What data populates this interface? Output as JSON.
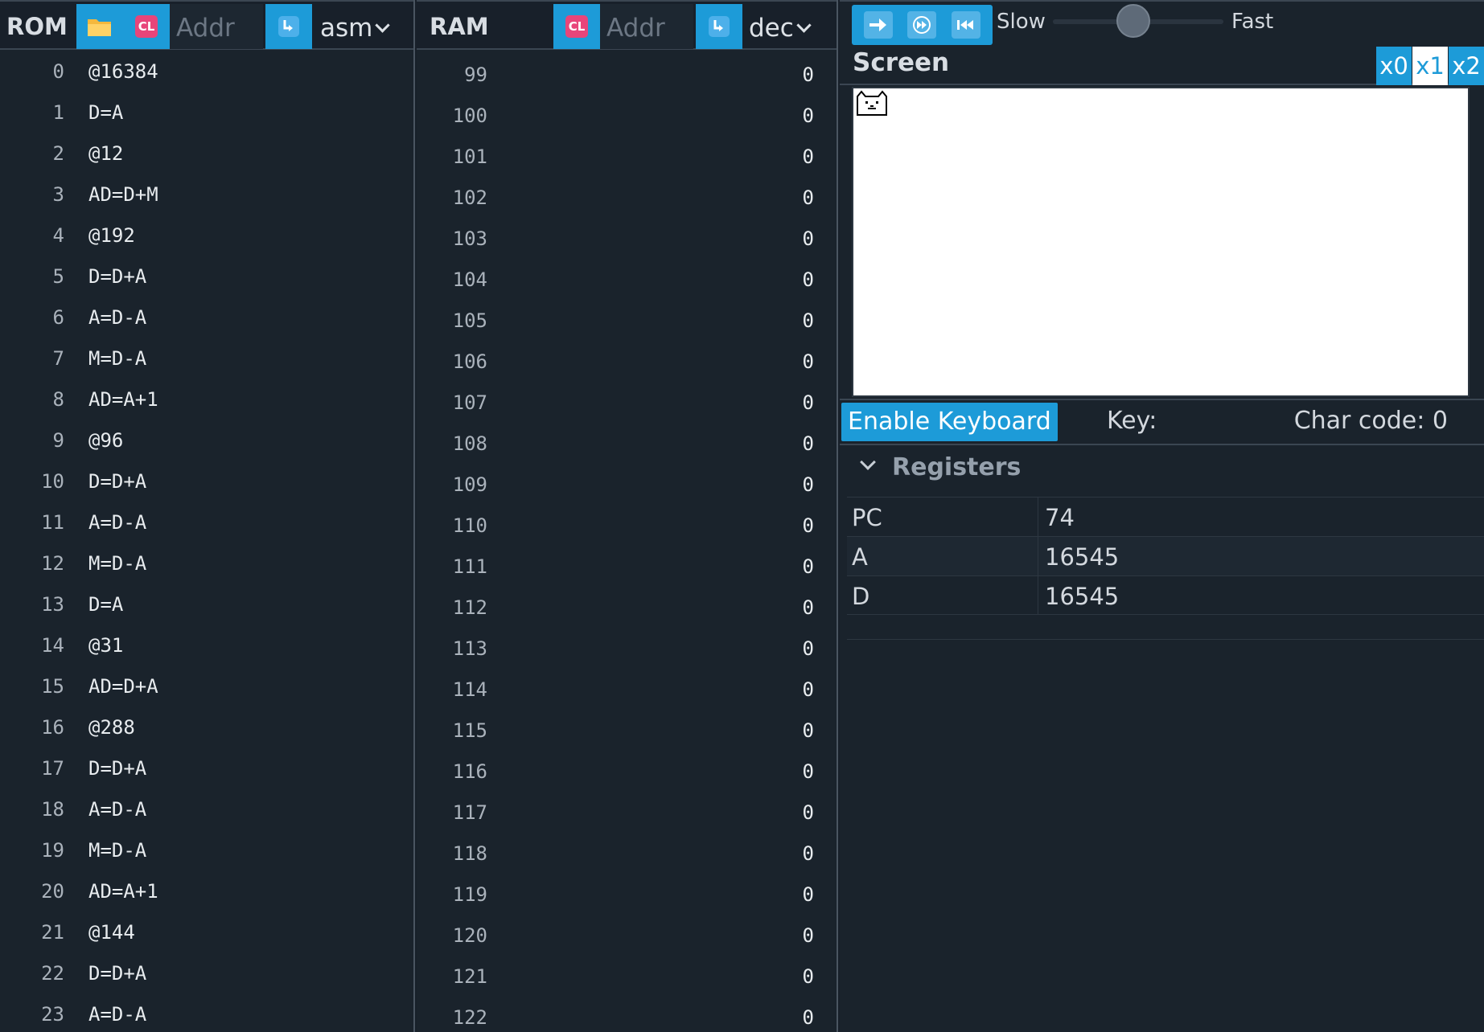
{
  "rom": {
    "title": "ROM",
    "addr_placeholder": "Addr",
    "format": "asm",
    "clear_label": "CL",
    "rows": [
      {
        "ln": "0",
        "code": "@16384"
      },
      {
        "ln": "1",
        "code": "D=A"
      },
      {
        "ln": "2",
        "code": "@12"
      },
      {
        "ln": "3",
        "code": "AD=D+M"
      },
      {
        "ln": "4",
        "code": "@192"
      },
      {
        "ln": "5",
        "code": "D=D+A"
      },
      {
        "ln": "6",
        "code": "A=D-A"
      },
      {
        "ln": "7",
        "code": "M=D-A"
      },
      {
        "ln": "8",
        "code": "AD=A+1"
      },
      {
        "ln": "9",
        "code": "@96"
      },
      {
        "ln": "10",
        "code": "D=D+A"
      },
      {
        "ln": "11",
        "code": "A=D-A"
      },
      {
        "ln": "12",
        "code": "M=D-A"
      },
      {
        "ln": "13",
        "code": "D=A"
      },
      {
        "ln": "14",
        "code": "@31"
      },
      {
        "ln": "15",
        "code": "AD=D+A"
      },
      {
        "ln": "16",
        "code": "@288"
      },
      {
        "ln": "17",
        "code": "D=D+A"
      },
      {
        "ln": "18",
        "code": "A=D-A"
      },
      {
        "ln": "19",
        "code": "M=D-A"
      },
      {
        "ln": "20",
        "code": "AD=A+1"
      },
      {
        "ln": "21",
        "code": "@144"
      },
      {
        "ln": "22",
        "code": "D=D+A"
      },
      {
        "ln": "23",
        "code": "A=D-A"
      }
    ]
  },
  "ram": {
    "title": "RAM",
    "addr_placeholder": "Addr",
    "format": "dec",
    "clear_label": "CL",
    "rows": [
      {
        "ln": "99",
        "val": "0"
      },
      {
        "ln": "100",
        "val": "0"
      },
      {
        "ln": "101",
        "val": "0"
      },
      {
        "ln": "102",
        "val": "0"
      },
      {
        "ln": "103",
        "val": "0"
      },
      {
        "ln": "104",
        "val": "0"
      },
      {
        "ln": "105",
        "val": "0"
      },
      {
        "ln": "106",
        "val": "0"
      },
      {
        "ln": "107",
        "val": "0"
      },
      {
        "ln": "108",
        "val": "0"
      },
      {
        "ln": "109",
        "val": "0"
      },
      {
        "ln": "110",
        "val": "0"
      },
      {
        "ln": "111",
        "val": "0"
      },
      {
        "ln": "112",
        "val": "0"
      },
      {
        "ln": "113",
        "val": "0"
      },
      {
        "ln": "114",
        "val": "0"
      },
      {
        "ln": "115",
        "val": "0"
      },
      {
        "ln": "116",
        "val": "0"
      },
      {
        "ln": "117",
        "val": "0"
      },
      {
        "ln": "118",
        "val": "0"
      },
      {
        "ln": "119",
        "val": "0"
      },
      {
        "ln": "120",
        "val": "0"
      },
      {
        "ln": "121",
        "val": "0"
      },
      {
        "ln": "122",
        "val": "0"
      }
    ]
  },
  "toolbar": {
    "speed_slow": "Slow",
    "speed_fast": "Fast",
    "speed_level": 0.47,
    "buttons": [
      "step-icon",
      "run-icon",
      "reset-icon"
    ]
  },
  "screen": {
    "title": "Screen",
    "scales": [
      "x0",
      "x1",
      "x2"
    ],
    "selected_scale": "x1"
  },
  "keyboard": {
    "enable_label": "Enable Keyboard",
    "key_label": "Key:",
    "char_code_label": "Char code: 0"
  },
  "registers": {
    "title": "Registers",
    "rows": [
      {
        "name": "PC",
        "value": "74"
      },
      {
        "name": "A",
        "value": "16545"
      },
      {
        "name": "D",
        "value": "16545"
      }
    ]
  },
  "colors": {
    "accent": "#1d9bd8",
    "clear_badge": "#e8457a",
    "background": "#1a232c"
  }
}
